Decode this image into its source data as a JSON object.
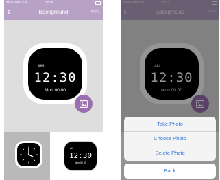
{
  "left_screen": {
    "status": {
      "carrier": "Three WiFi Call",
      "time": "17:42"
    },
    "nav": {
      "back_glyph": "‹",
      "title": "Background",
      "apply": "Apply"
    },
    "clock": {
      "ampm": "AM",
      "time": "12:30",
      "date": "Mon.00 00"
    },
    "photo_button_icon": "image-icon",
    "thumbnails": [
      {
        "kind": "analog-clock",
        "selected": true
      },
      {
        "kind": "digital-clock",
        "ampm": "AM",
        "time": "12:30",
        "date": "Mon.00 00"
      }
    ]
  },
  "right_screen": {
    "status": {
      "carrier": "Three WiFi Call",
      "time": "17:42"
    },
    "nav": {
      "back_glyph": "‹",
      "title": "Background",
      "apply": "Apply"
    },
    "clock": {
      "ampm": "AM",
      "time": "12:30",
      "date": "Mon.00 00"
    },
    "action_sheet": {
      "items": [
        "Take Photo",
        "Choose Photo",
        "Delete Photo"
      ],
      "back_label": "Back"
    }
  },
  "colors": {
    "header": "#b7a2c6",
    "accent": "#9b6eb0",
    "action_text": "#3478d8"
  }
}
